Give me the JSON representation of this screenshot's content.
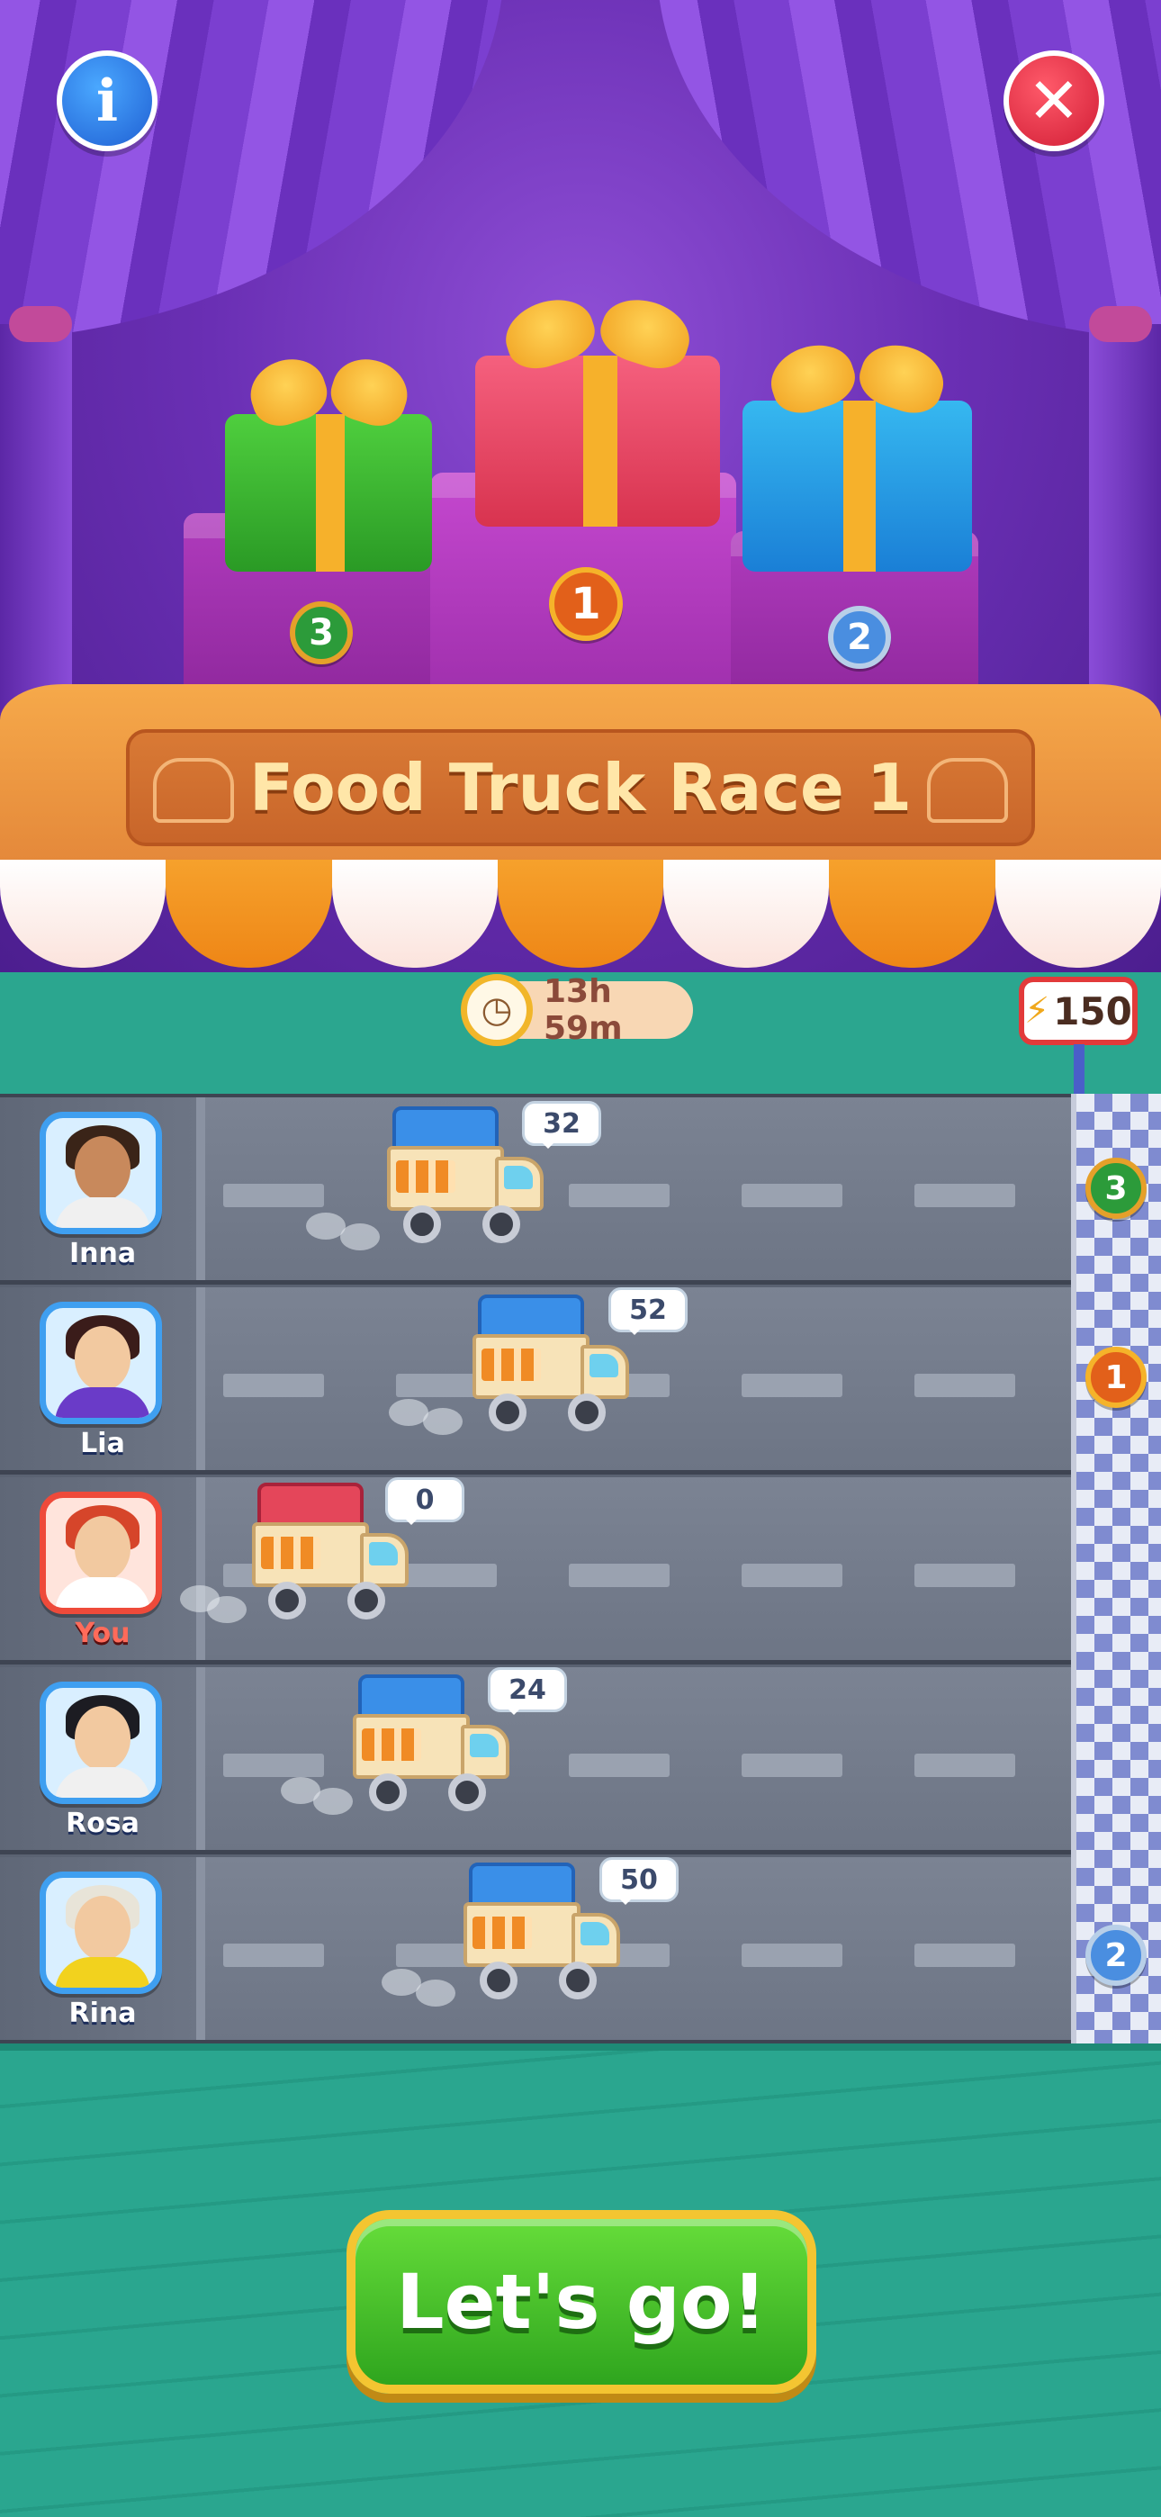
{
  "header": {
    "info_icon": "info-icon",
    "close_icon": "close-icon",
    "info_glyph": "i",
    "close_glyph": "✕"
  },
  "podium": {
    "third_place": "3",
    "first_place": "1",
    "second_place": "2"
  },
  "banner": {
    "title": "Food Truck Race 1"
  },
  "timer": {
    "icon": "clock-icon",
    "remaining": "13h 59m"
  },
  "energy": {
    "icon": "lightning-icon",
    "value": "150"
  },
  "race": {
    "lanes": [
      {
        "name": "Inna",
        "score": "32",
        "progress": 32,
        "truck_color": "blue",
        "is_player": false
      },
      {
        "name": "Lia",
        "score": "52",
        "progress": 52,
        "truck_color": "blue",
        "is_player": false
      },
      {
        "name": "You",
        "score": "0",
        "progress": 0,
        "truck_color": "red",
        "is_player": true
      },
      {
        "name": "Rosa",
        "score": "24",
        "progress": 24,
        "truck_color": "blue",
        "is_player": false
      },
      {
        "name": "Rina",
        "score": "50",
        "progress": 50,
        "truck_color": "blue",
        "is_player": false
      }
    ],
    "finish_medals": [
      "3",
      "1",
      "2"
    ]
  },
  "cta": {
    "label": "Let's go!"
  },
  "colors": {
    "teal": "#2aa68f",
    "curtain_purple": "#7b3fd0",
    "button_green": "#3fb829",
    "player_accent": "#ee4a3a"
  }
}
